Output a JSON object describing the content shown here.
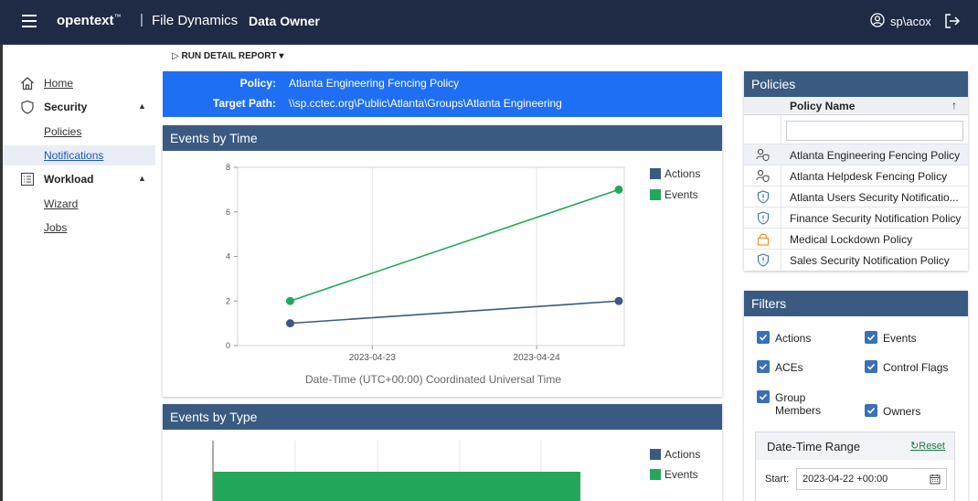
{
  "topbar": {
    "brand": "opentext",
    "brand_sup": "™",
    "separator": "|",
    "product": "File Dynamics",
    "role": "Data Owner",
    "user": "sp\\acox"
  },
  "nav": {
    "home": "Home",
    "security": "Security",
    "policies": "Policies",
    "notifications": "Notifications",
    "workload": "Workload",
    "wizard": "Wizard",
    "jobs": "Jobs"
  },
  "toolbar": {
    "run_detail_report": "RUN DETAIL REPORT"
  },
  "banner": {
    "policy_key": "Policy:",
    "policy_value": "Atlanta Engineering Fencing Policy",
    "target_key": "Target Path:",
    "target_value": "\\\\sp.cctec.org\\Public\\Atlanta\\Groups\\Atlanta Engineering"
  },
  "events_by_time": {
    "title": "Events by Time",
    "xlabel": "Date-Time   (UTC+00:00) Coordinated Universal Time"
  },
  "events_by_type": {
    "title": "Events by Type"
  },
  "chart_data": [
    {
      "type": "line",
      "title": "Events by Time",
      "xlabel": "Date-Time   (UTC+00:00) Coordinated Universal Time",
      "ylabel": "",
      "x_ticks": [
        "2023-04-23",
        "2023-04-24"
      ],
      "y_ticks": [
        0,
        2,
        4,
        6,
        8
      ],
      "ylim": [
        0,
        8
      ],
      "series": [
        {
          "name": "Actions",
          "color": "#3a5a82",
          "points": [
            {
              "x": "2023-04-22 12:00",
              "y": 1
            },
            {
              "x": "2023-04-24 12:00",
              "y": 2
            }
          ]
        },
        {
          "name": "Events",
          "color": "#22a85a",
          "points": [
            {
              "x": "2023-04-22 12:00",
              "y": 2
            },
            {
              "x": "2023-04-24 12:00",
              "y": 7
            }
          ]
        }
      ],
      "grid": "vertical",
      "legend": "top-right"
    },
    {
      "type": "bar",
      "title": "Events by Type",
      "series": [
        {
          "name": "Actions",
          "color": "#3a5a82"
        },
        {
          "name": "Events",
          "color": "#22a85a"
        }
      ],
      "legend": "top-right"
    }
  ],
  "policies": {
    "title": "Policies",
    "column": "Policy Name",
    "sort_glyph": "↑",
    "filter_value": "",
    "rows": [
      {
        "name": "Atlanta Engineering Fencing Policy",
        "icon": "fencing-icon",
        "selected": true
      },
      {
        "name": "Atlanta Helpdesk Fencing Policy",
        "icon": "fencing-icon"
      },
      {
        "name": "Atlanta Users Security Notificatio...",
        "icon": "shield-icon"
      },
      {
        "name": "Finance Security Notification Policy",
        "icon": "shield-icon"
      },
      {
        "name": "Medical Lockdown Policy",
        "icon": "lock-icon"
      },
      {
        "name": "Sales Security Notification Policy",
        "icon": "shield-icon"
      }
    ]
  },
  "filters": {
    "title": "Filters",
    "actions": "Actions",
    "events": "Events",
    "aces": "ACEs",
    "control_flags": "Control Flags",
    "group_members_1": "Group",
    "group_members_2": "Members",
    "owners": "Owners",
    "date_time_range": "Date-Time Range",
    "reset": "Reset",
    "start_label": "Start:",
    "start_value": "2023-04-22 +00:00"
  },
  "colors": {
    "topbar": "#1f2a44",
    "banner": "#1f6ff5",
    "panel_head": "#3a5a82",
    "actions": "#3a5a82",
    "events": "#22a85a"
  }
}
